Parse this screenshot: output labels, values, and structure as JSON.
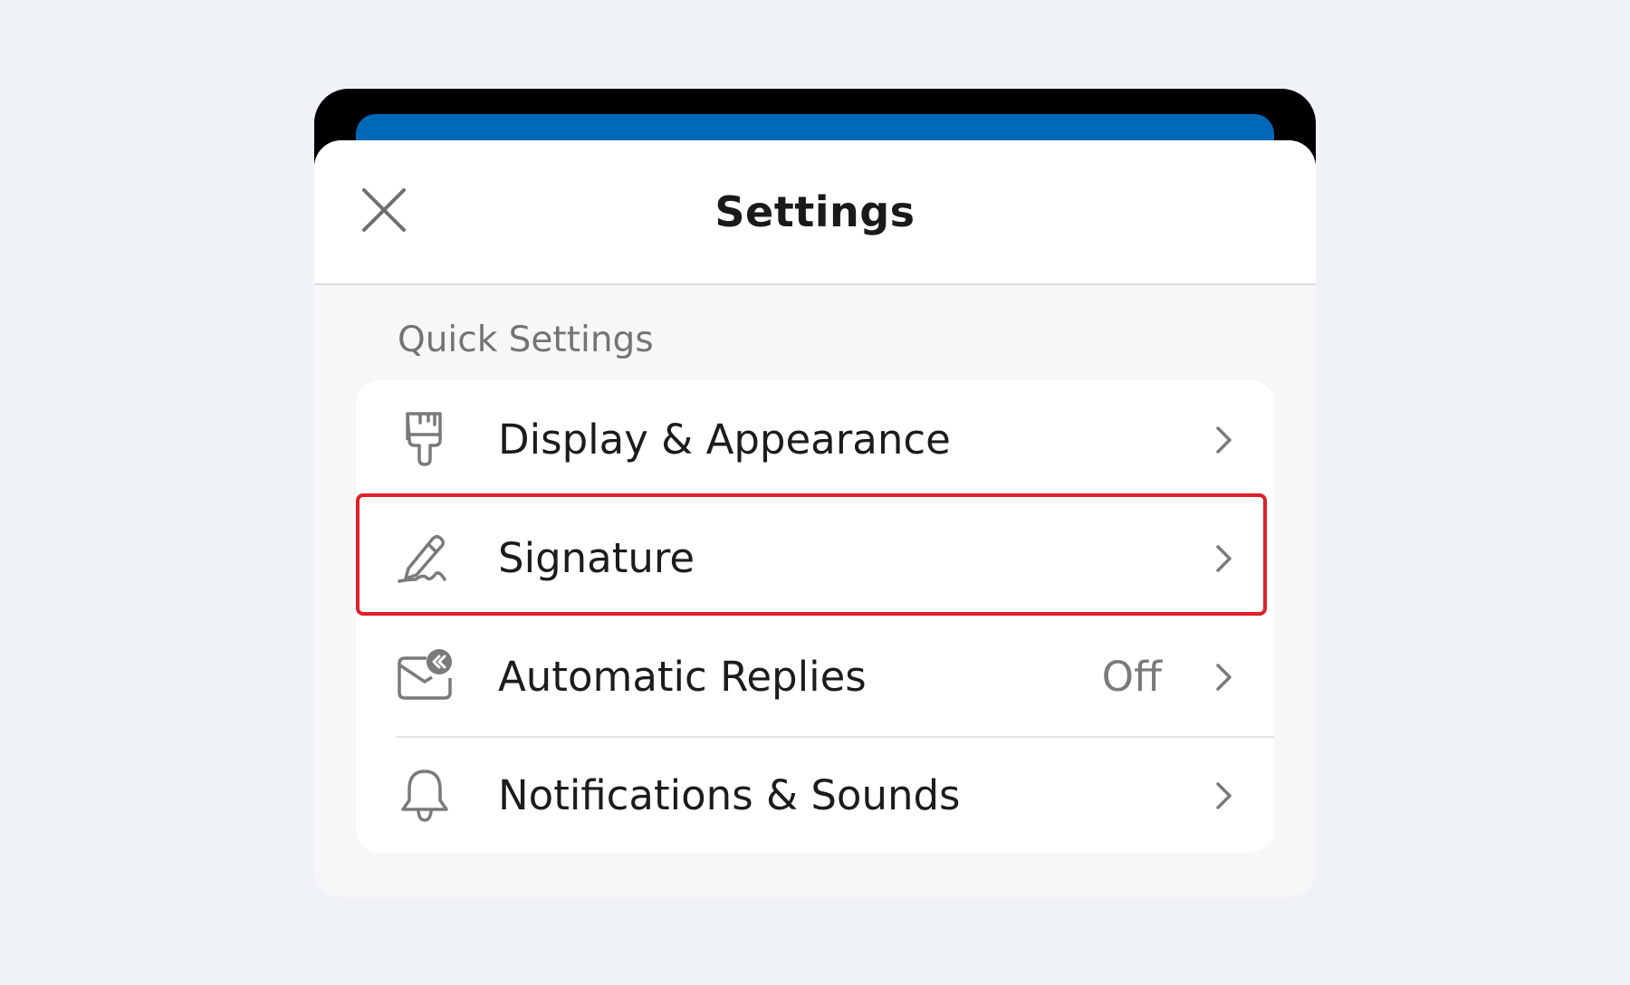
{
  "header": {
    "title": "Settings",
    "close_icon": "close-icon"
  },
  "section": {
    "label": "Quick Settings"
  },
  "items": [
    {
      "label": "Display & Appearance",
      "icon": "paintbrush-icon",
      "value": ""
    },
    {
      "label": "Signature",
      "icon": "signature-pen-icon",
      "value": ""
    },
    {
      "label": "Automatic Replies",
      "icon": "auto-reply-mail-icon",
      "value": "Off"
    },
    {
      "label": "Notifications & Sounds",
      "icon": "bell-icon",
      "value": ""
    }
  ],
  "colors": {
    "page_background": "#eff3f8",
    "accent_blue": "#0068b8",
    "highlight_red": "#e0202a",
    "icon_gray": "#7a7a7a"
  }
}
